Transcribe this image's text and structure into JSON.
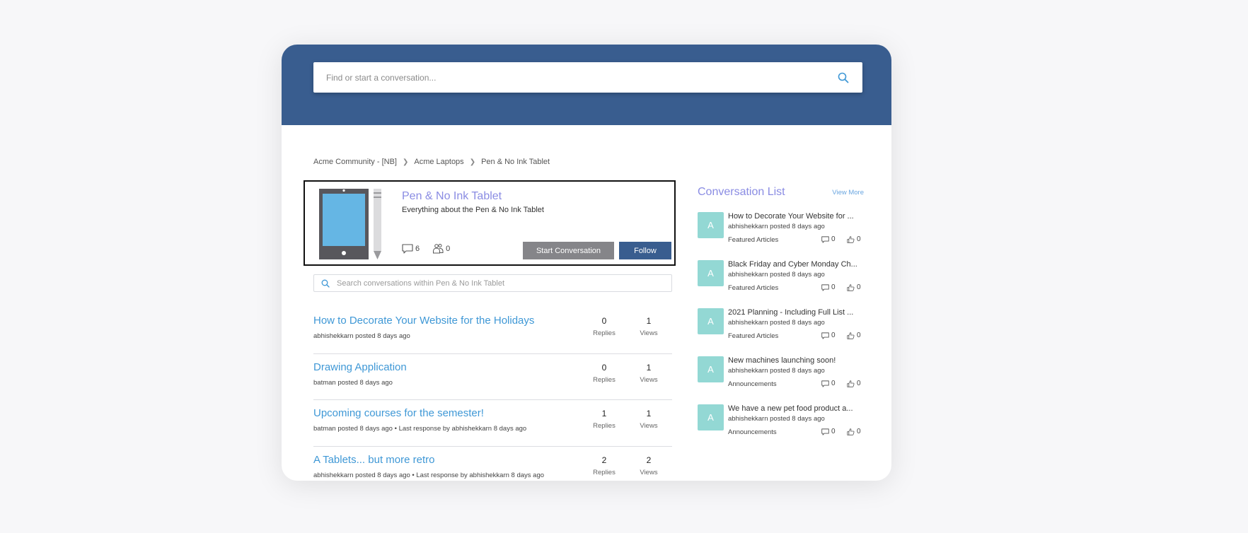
{
  "header": {
    "search_placeholder": "Find or start a conversation...",
    "search_icon": "search-icon",
    "brand_color": "#395d8f"
  },
  "breadcrumb": {
    "items": [
      "Acme Community - [NB]",
      "Acme Laptops",
      "Pen & No Ink Tablet"
    ],
    "separator": ">"
  },
  "board": {
    "title": "Pen & No Ink Tablet",
    "description": "Everything about the Pen & No Ink Tablet",
    "conversations_count": "6",
    "followers_count": "0",
    "start_conversation_label": "Start Conversation",
    "follow_label": "Follow",
    "image": "tablet-and-pen-illustration"
  },
  "inner_search": {
    "placeholder": "Search conversations within Pen & No Ink Tablet"
  },
  "threads": [
    {
      "title": "How to Decorate Your Website for the Holidays",
      "meta": "abhishekkarn posted 8 days ago",
      "replies": "0",
      "views": "1"
    },
    {
      "title": "Drawing Application",
      "meta": "batman posted 8 days ago",
      "replies": "0",
      "views": "1"
    },
    {
      "title": "Upcoming courses for the semester!",
      "meta": "batman posted 8 days ago • Last response by abhishekkarn 8 days ago",
      "replies": "1",
      "views": "1"
    },
    {
      "title": "A Tablets... but more retro",
      "meta": "abhishekkarn posted 8 days ago • Last response by abhishekkarn 8 days ago",
      "replies": "2",
      "views": "2"
    }
  ],
  "labels": {
    "replies": "Replies",
    "views": "Views"
  },
  "sidebar": {
    "title": "Conversation List",
    "view_more": "View More",
    "items": [
      {
        "avatar": "A",
        "title": "How to Decorate Your Website for ...",
        "meta": "abhishekkarn posted 8 days ago",
        "category": "Featured Articles",
        "comments": "0",
        "likes": "0"
      },
      {
        "avatar": "A",
        "title": "Black Friday and Cyber Monday Ch...",
        "meta": "abhishekkarn posted 8 days ago",
        "category": "Featured Articles",
        "comments": "0",
        "likes": "0"
      },
      {
        "avatar": "A",
        "title": "2021 Planning - Including Full List ...",
        "meta": "abhishekkarn posted 8 days ago",
        "category": "Featured Articles",
        "comments": "0",
        "likes": "0"
      },
      {
        "avatar": "A",
        "title": "New machines launching soon!",
        "meta": "abhishekkarn posted 8 days ago",
        "category": "Announcements",
        "comments": "0",
        "likes": "0"
      },
      {
        "avatar": "A",
        "title": "We have a new pet food product a...",
        "meta": "abhishekkarn posted 8 days ago",
        "category": "Announcements",
        "comments": "0",
        "likes": "0"
      }
    ]
  }
}
